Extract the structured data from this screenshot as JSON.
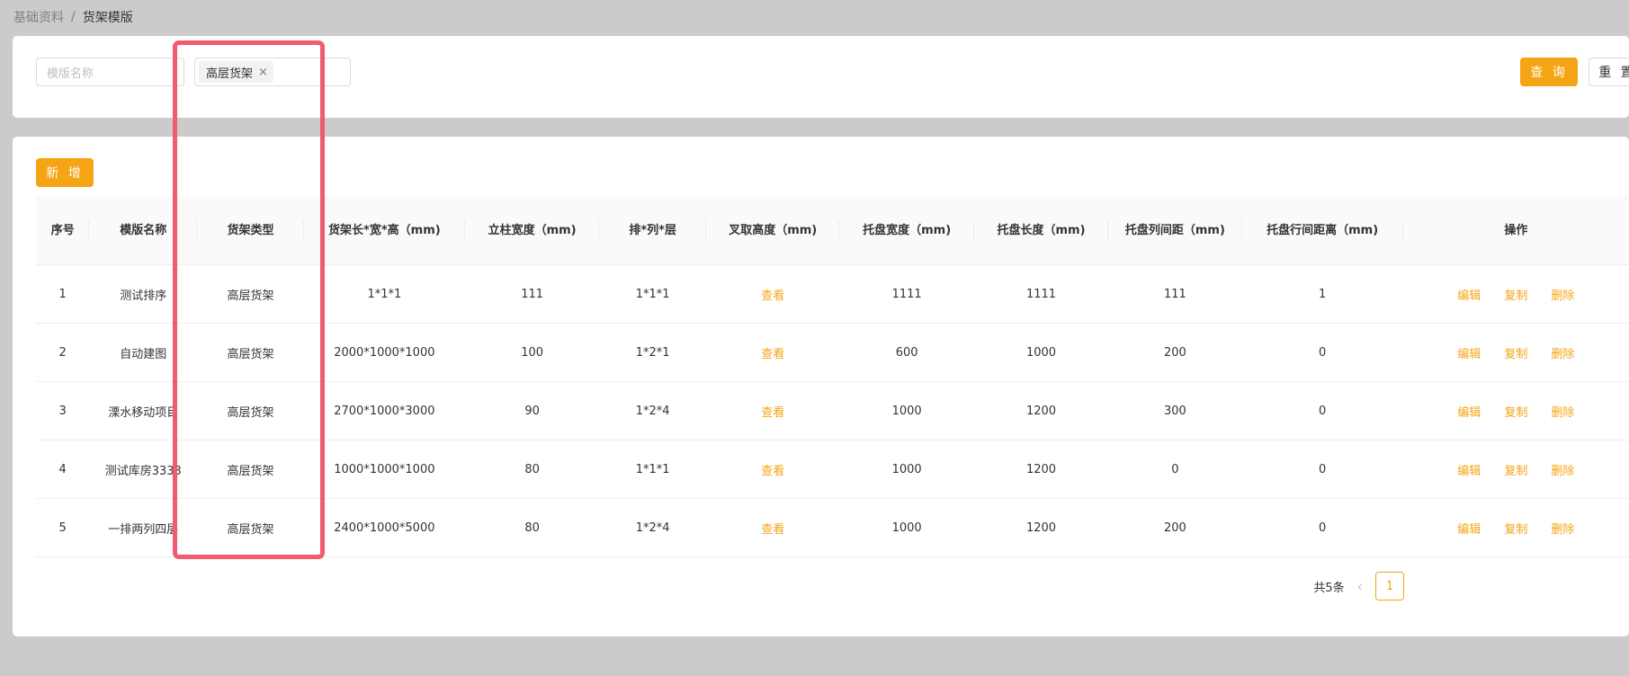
{
  "breadcrumb": {
    "root": "基础资料",
    "separator": "/",
    "current": "货架模版"
  },
  "search": {
    "name_placeholder": "模版名称",
    "selected_type_tag": "高层货架",
    "tag_close": "×",
    "query_label": "查 询",
    "reset_label": "重 置"
  },
  "toolbar": {
    "add_label": "新 增"
  },
  "table": {
    "columns": [
      "序号",
      "模版名称",
      "货架类型",
      "货架长*宽*高（mm)",
      "立柱宽度（mm)",
      "排*列*层",
      "叉取高度（mm)",
      "托盘宽度（mm)",
      "托盘长度（mm)",
      "托盘列间距（mm)",
      "托盘行间距离（mm)",
      "操作"
    ],
    "rows": [
      {
        "index": "1",
        "name": "测试排序",
        "type": "高层货架",
        "dims": "1*1*1",
        "post_width": "111",
        "layout": "1*1*1",
        "fork_height": "查看",
        "pallet_width": "1111",
        "pallet_length": "1111",
        "col_spacing": "111",
        "row_spacing": "1"
      },
      {
        "index": "2",
        "name": "自动建图",
        "type": "高层货架",
        "dims": "2000*1000*1000",
        "post_width": "100",
        "layout": "1*2*1",
        "fork_height": "查看",
        "pallet_width": "600",
        "pallet_length": "1000",
        "col_spacing": "200",
        "row_spacing": "0"
      },
      {
        "index": "3",
        "name": "溧水移动项目",
        "type": "高层货架",
        "dims": "2700*1000*3000",
        "post_width": "90",
        "layout": "1*2*4",
        "fork_height": "查看",
        "pallet_width": "1000",
        "pallet_length": "1200",
        "col_spacing": "300",
        "row_spacing": "0"
      },
      {
        "index": "4",
        "name": "测试库房3333",
        "type": "高层货架",
        "dims": "1000*1000*1000",
        "post_width": "80",
        "layout": "1*1*1",
        "fork_height": "查看",
        "pallet_width": "1000",
        "pallet_length": "1200",
        "col_spacing": "0",
        "row_spacing": "0"
      },
      {
        "index": "5",
        "name": "一排两列四层",
        "type": "高层货架",
        "dims": "2400*1000*5000",
        "post_width": "80",
        "layout": "1*2*4",
        "fork_height": "查看",
        "pallet_width": "1000",
        "pallet_length": "1200",
        "col_spacing": "200",
        "row_spacing": "0"
      }
    ],
    "actions": {
      "edit": "编辑",
      "copy": "复制",
      "delete": "删除"
    }
  },
  "pagination": {
    "total": "共5条",
    "prev": "‹",
    "current_page": "1"
  },
  "colors": {
    "accent": "#f5a413",
    "highlight": "#f25a70",
    "background": "#cbcbcb"
  }
}
